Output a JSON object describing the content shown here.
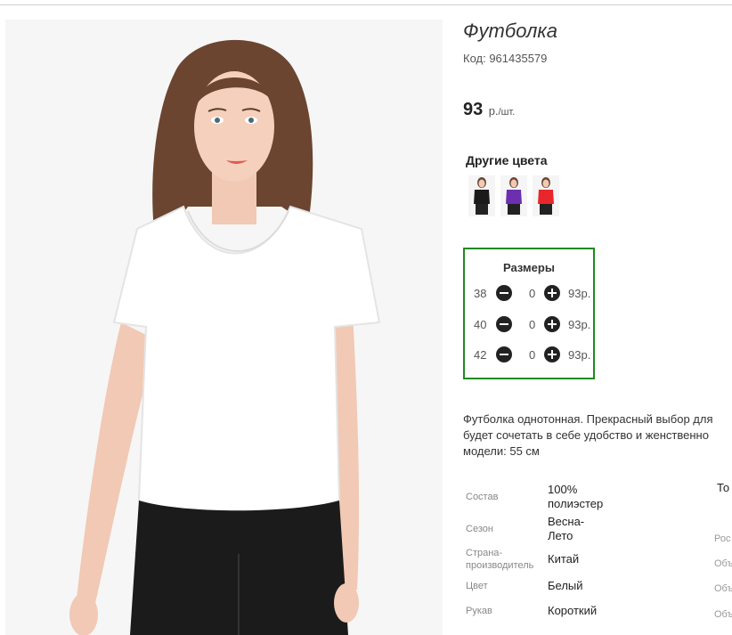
{
  "product": {
    "title": "Футболка",
    "code": "Код: 961435579",
    "price_value": "93",
    "price_unit_main": "р.",
    "price_unit_small": "/шт."
  },
  "colors": {
    "heading": "Другие цвета",
    "swatches": [
      {
        "name": "black",
        "color": "#1a1a1a"
      },
      {
        "name": "purple",
        "color": "#6b2fb0"
      },
      {
        "name": "red",
        "color": "#e8262b"
      }
    ]
  },
  "sizes": {
    "heading": "Размеры",
    "border_color": "#1f8a1f",
    "rows": [
      {
        "size": "38",
        "qty": "0",
        "price": "93р."
      },
      {
        "size": "40",
        "qty": "0",
        "price": "93р."
      },
      {
        "size": "42",
        "qty": "0",
        "price": "93р."
      }
    ]
  },
  "description": {
    "lines": [
      "Футболка однотонная. Прекрасный выбор для",
      "будет сочетать в себе удобство и женственно",
      "модели: 55 см"
    ]
  },
  "specs": [
    {
      "label": "Состав",
      "value_lines": [
        "100%",
        "полиэстер"
      ]
    },
    {
      "label": "Сезон",
      "value_lines": [
        "Весна-",
        "Лето"
      ]
    },
    {
      "label_lines": [
        "Страна-",
        "производитель"
      ],
      "value_lines": [
        "Китай"
      ]
    },
    {
      "label": "Цвет",
      "value_lines": [
        "Белый"
      ]
    },
    {
      "label": "Рукав",
      "value_lines": [
        "Короткий"
      ]
    }
  ],
  "cut_off": {
    "header": "То",
    "labels": [
      "Рос",
      "Объ",
      "Объ",
      "Объ"
    ]
  }
}
